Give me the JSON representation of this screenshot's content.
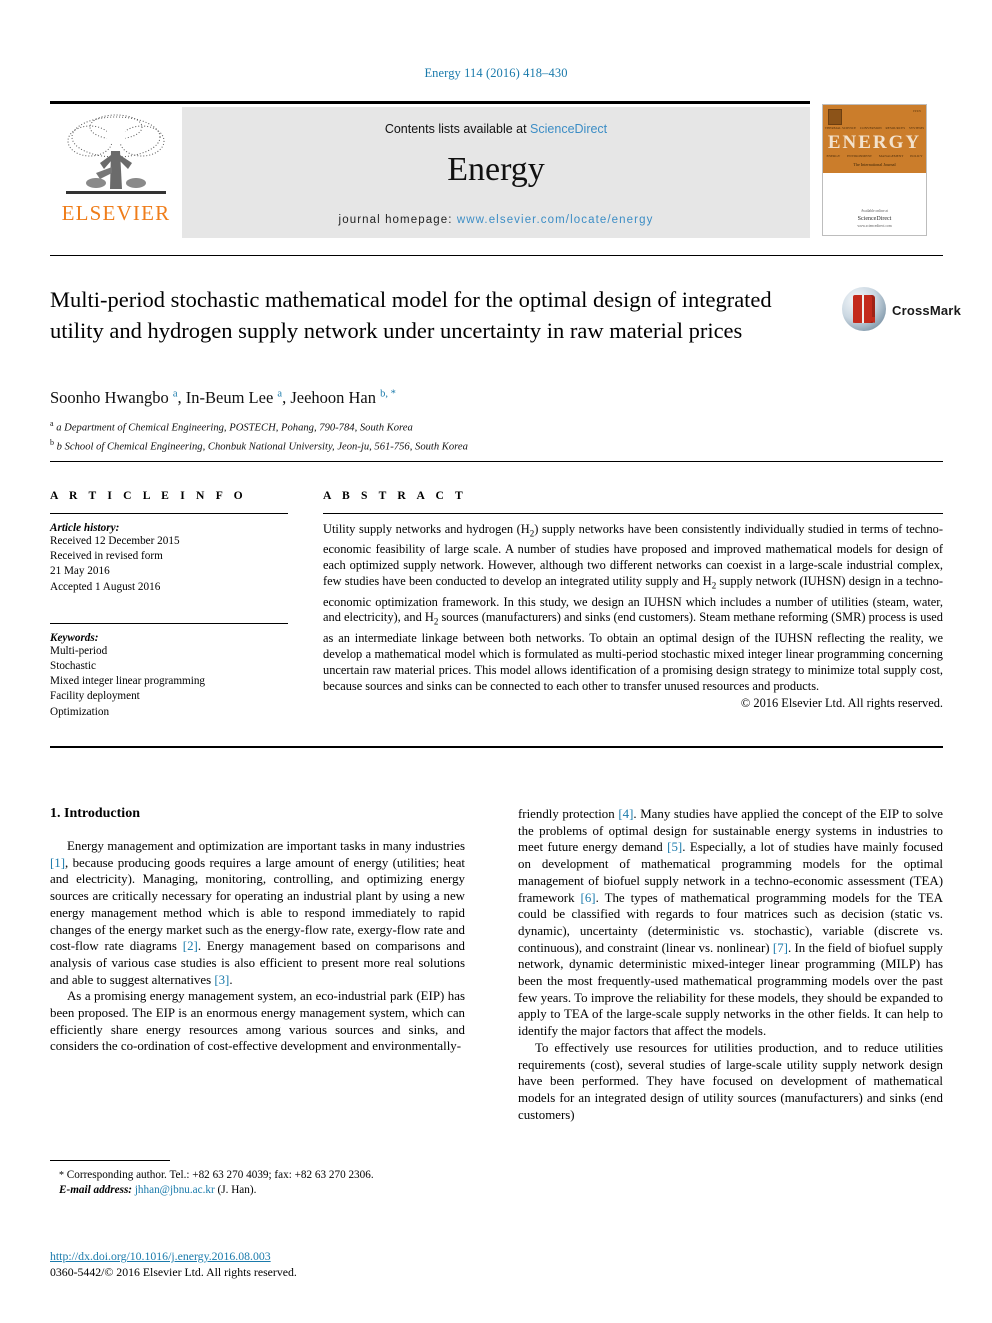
{
  "running_head": "Energy 114 (2016) 418–430",
  "masthead": {
    "publisher": "ELSEVIER",
    "contents_prefix": "Contents lists available at ",
    "contents_link": "ScienceDirect",
    "journal_title": "Energy",
    "homepage_prefix": "journal homepage: ",
    "homepage_url": "www.elsevier.com/locate/energy"
  },
  "cover": {
    "title": "ENERGY",
    "subtitle": "The International Journal",
    "issn": "ISSN",
    "top_words": [
      "THERMAL SCIENCE",
      "CONVERSION",
      "RESOURCES",
      "SYSTEMS"
    ],
    "bottom_words": [
      "ENERGY",
      "ENVIRONMENT",
      "MANAGEMENT",
      "POLICY"
    ],
    "foot_small": "Available online at",
    "foot_big": "ScienceDirect",
    "foot_url": "www.sciencedirect.com"
  },
  "crossmark": {
    "label": "CrossMark"
  },
  "article": {
    "title": "Multi-period stochastic mathematical model for the optimal design of integrated utility and hydrogen supply network under uncertainty in raw material prices",
    "authors_html": "Soonho Hwangbo <sup>a</sup>, In-Beum Lee <sup>a</sup>, Jeehoon Han <sup>b, *</sup>",
    "affiliations": [
      "a Department of Chemical Engineering, POSTECH, Pohang, 790-784, South Korea",
      "b School of Chemical Engineering, Chonbuk National University, Jeon-ju, 561-756, South Korea"
    ]
  },
  "article_info": {
    "heading": "A R T I C L E   I N F O",
    "history_label": "Article history:",
    "history": [
      "Received 12 December 2015",
      "Received in revised form",
      "21 May 2016",
      "Accepted 1 August 2016"
    ],
    "keywords_label": "Keywords:",
    "keywords": [
      "Multi-period",
      "Stochastic",
      "Mixed integer linear programming",
      "Facility deployment",
      "Optimization"
    ]
  },
  "abstract": {
    "heading": "A B S T R A C T",
    "text_html": "Utility supply networks and hydrogen (H<sub>2</sub>) supply networks have been consistently individually studied in terms of techno-economic feasibility of large scale. A number of studies have proposed and improved mathematical models for design of each optimized supply network. However, although two different networks can coexist in a large-scale industrial complex, few studies have been conducted to develop an integrated utility supply and H<sub>2</sub> supply network (IUHSN) design in a techno-economic optimization framework. In this study, we design an IUHSN which includes a number of utilities (steam, water, and electricity), and H<sub>2</sub> sources (manufacturers) and sinks (end customers). Steam methane reforming (SMR) process is used as an intermediate linkage between both networks. To obtain an optimal design of the IUHSN reflecting the reality, we develop a mathematical model which is formulated as multi-period stochastic mixed integer linear programming concerning uncertain raw material prices. This model allows identification of a promising design strategy to minimize total supply cost, because sources and sinks can be connected to each other to transfer unused resources and products.",
    "copyright": "© 2016 Elsevier Ltd. All rights reserved."
  },
  "body": {
    "section_number_title": "1. Introduction",
    "left_paragraphs_html": [
      "Energy management and optimization are important tasks in many industries <span class=\"ref\">[1]</span>, because producing goods requires a large amount of energy (utilities; heat and electricity). Managing, monitoring, controlling, and optimizing energy sources are critically necessary for operating an industrial plant by using a new energy management method which is able to respond immediately to rapid changes of the energy market such as the energy-flow rate, exergy-flow rate and cost-flow rate diagrams <span class=\"ref\">[2]</span>. Energy management based on comparisons and analysis of various case studies is also efficient to present more real solutions and able to suggest alternatives <span class=\"ref\">[3]</span>.",
      "As a promising energy management system, an eco-industrial park (EIP) has been proposed. The EIP is an enormous energy management system, which can efficiently share energy resources among various sources and sinks, and considers the co-ordination of cost-effective development and environmentally-"
    ],
    "right_paragraphs_html": [
      "friendly protection <span class=\"ref\">[4]</span>. Many studies have applied the concept of the EIP to solve the problems of optimal design for sustainable energy systems in industries to meet future energy demand <span class=\"ref\">[5]</span>. Especially, a lot of studies have mainly focused on development of mathematical programming models for the optimal management of biofuel supply network in a techno-economic assessment (TEA) framework <span class=\"ref\">[6]</span>. The types of mathematical programming models for the TEA could be classified with regards to four matrices such as decision (static vs. dynamic), uncertainty (deterministic vs. stochastic), variable (discrete vs. continuous), and constraint (linear vs. nonlinear) <span class=\"ref\">[7]</span>. In the field of biofuel supply network, dynamic deterministic mixed-integer linear programming (MILP) has been the most frequently-used mathematical programming models over the past few years. To improve the reliability for these models, they should be expanded to apply to TEA of the large-scale supply networks in the other fields. It can help to identify the major factors that affect the models.",
      "To effectively use resources for utilities production, and to reduce utilities requirements (cost), several studies of large-scale utility supply network design have been performed. They have focused on development of mathematical models for an integrated design of utility sources (manufacturers) and sinks (end customers)"
    ]
  },
  "footnote": {
    "corresponding_html": "<span class=\"star\">*</span> Corresponding author. Tel.: +82 63 270 4039; fax: +82 63 270 2306.",
    "email_label": "E-mail address:",
    "email": "jhhan@jbnu.ac.kr",
    "email_suffix": "(J. Han)."
  },
  "doi_block": {
    "doi_url": "http://dx.doi.org/10.1016/j.energy.2016.08.003",
    "issn_line": "0360-5442/© 2016 Elsevier Ltd. All rights reserved."
  },
  "colors": {
    "link": "#1a7aab",
    "elsevier_orange": "#ef7d1a",
    "science_direct": "#3c8dc5",
    "cover_orange": "#cb7d2b"
  }
}
